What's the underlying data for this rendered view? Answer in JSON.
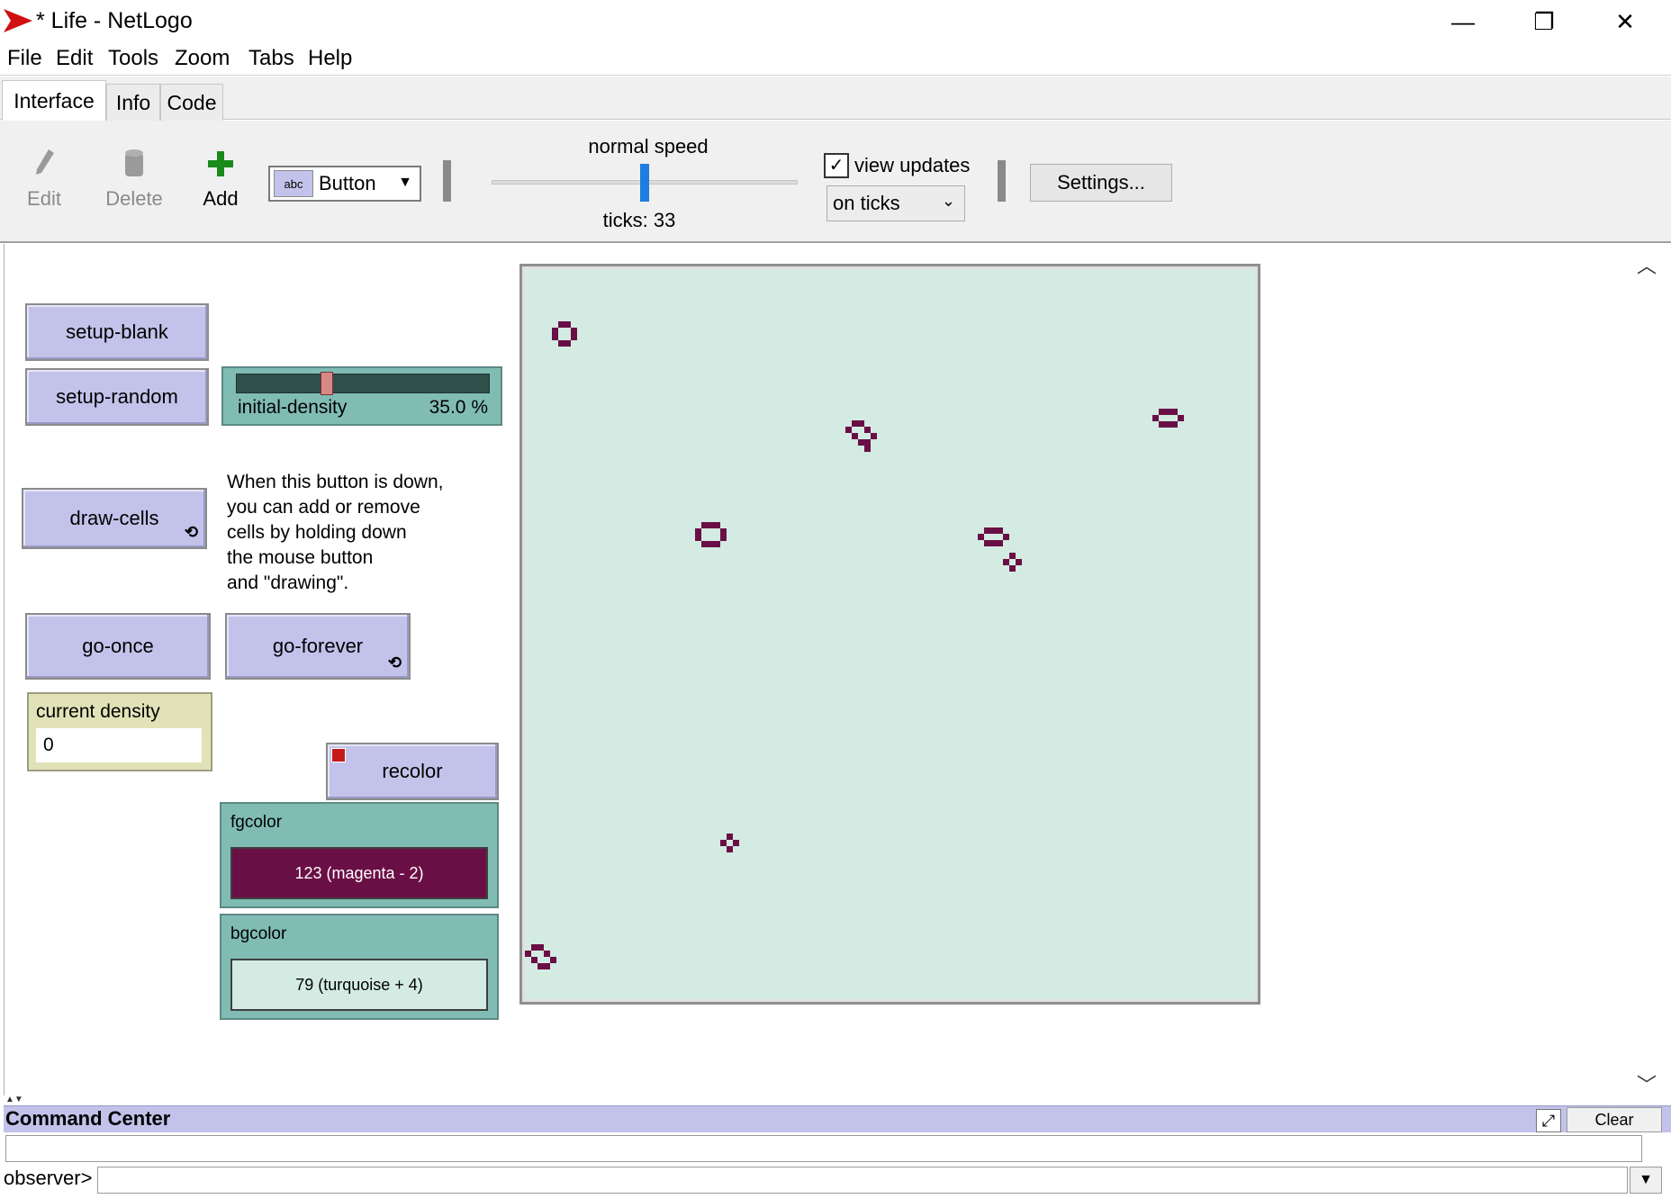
{
  "window": {
    "title": "* Life - NetLogo",
    "minimize": "—",
    "restore": "❐",
    "close": "✕"
  },
  "menu": [
    "File",
    "Edit",
    "Tools",
    "Zoom",
    "Tabs",
    "Help"
  ],
  "tabs": [
    "Interface",
    "Info",
    "Code"
  ],
  "toolbar": {
    "edit_label": "Edit",
    "delete_label": "Delete",
    "add_label": "Add",
    "widget_type": "Button",
    "speed_label": "normal speed",
    "speed_level": 0.5,
    "ticks_text": "ticks: 33",
    "view_updates_label": "view updates",
    "view_updates_checked": true,
    "update_mode": "on ticks",
    "settings_label": "Settings..."
  },
  "widgets": {
    "setup_blank": "setup-blank",
    "setup_random": "setup-random",
    "slider": {
      "name": "initial-density",
      "value_text": "35.0 %",
      "fraction": 0.35
    },
    "draw_cells": "draw-cells",
    "note": "When this button is down,\nyou can add or remove\ncells by holding down\nthe mouse button\nand \"drawing\".",
    "go_once": "go-once",
    "go_forever": "go-forever",
    "monitor": {
      "label": "current density",
      "value": "0"
    },
    "recolor": "recolor",
    "fgcolor": {
      "label": "fgcolor",
      "value": "123 (magenta - 2)",
      "color": "#6a0f45"
    },
    "bgcolor": {
      "label": "bgcolor",
      "value": "79 (turquoise + 4)",
      "color": "#d3ebe3"
    }
  },
  "colors": {
    "button_bg": "#c2c2ea",
    "slider_bg": "#80bcb4",
    "monitor_bg": "#e2e2b8",
    "cell": "#6a0f45",
    "world_bg": "#d3ebe3"
  },
  "command_center": {
    "title": "Command Center",
    "clear_label": "Clear",
    "prompt": "observer>",
    "input": ""
  }
}
